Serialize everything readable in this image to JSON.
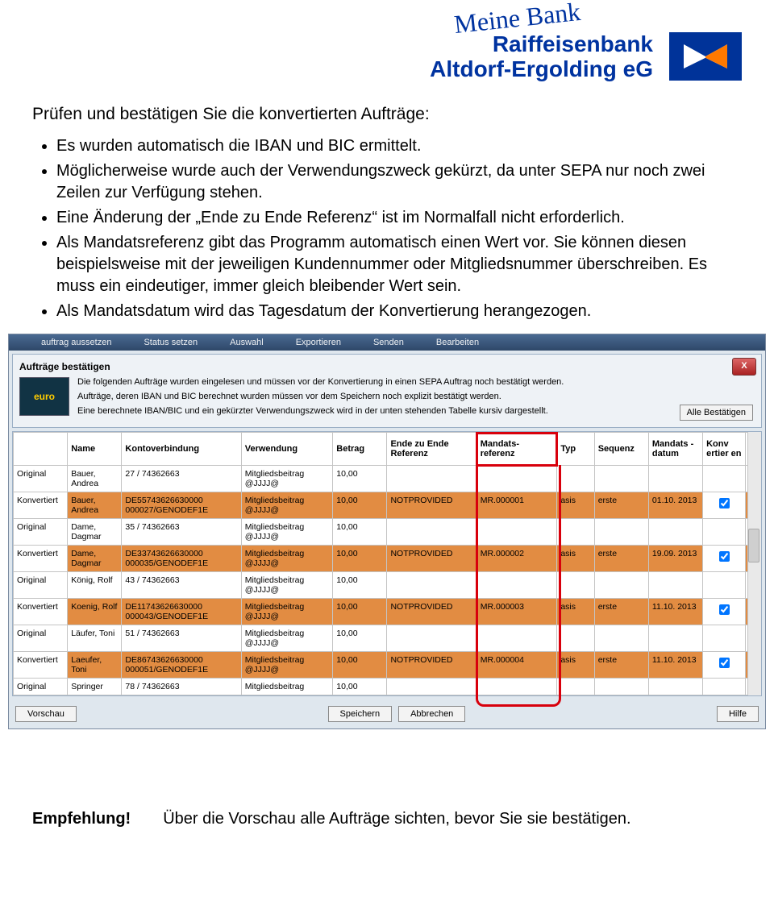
{
  "header": {
    "meine": "Meine Bank",
    "bank1": "Raiffeisenbank",
    "bank2": "Altdorf-Ergolding eG"
  },
  "intro": "Prüfen und bestätigen Sie die konvertierten Aufträge:",
  "bullets": [
    "Es wurden automatisch die IBAN und BIC ermittelt.",
    "Möglicherweise wurde auch der Verwendungszweck gekürzt, da unter SEPA nur noch zwei Zeilen zur Verfügung stehen.",
    "Eine Änderung der „Ende zu Ende Referenz“ ist im Normalfall nicht erforderlich.",
    "Als Mandatsreferenz gibt das Programm automatisch einen Wert vor. Sie können diesen beispielsweise mit der jeweiligen Kundennummer oder Mitgliedsnummer überschreiben. Es muss ein eindeutiger, immer gleich bleibender Wert sein.",
    "Als Mandatsdatum wird das Tagesdatum der Konvertierung herangezogen."
  ],
  "toolbar": [
    "auftrag aussetzen",
    "Status setzen",
    "Auswahl",
    "Exportieren",
    "Senden",
    "Bearbeiten"
  ],
  "dialog": {
    "title": "Aufträge bestätigen",
    "line1": "Die folgenden Aufträge wurden eingelesen und müssen vor der Konvertierung in einen SEPA Auftrag noch bestätigt werden.",
    "line2": "Aufträge, deren IBAN und BIC berechnet wurden müssen vor dem Speichern noch explizit bestätigt werden.",
    "line3": "Eine berechnete IBAN/BIC und ein gekürzter Verwendungszweck wird in der unten stehenden Tabelle kursiv dargestellt.",
    "euro": "euro",
    "alle": "Alle Bestätigen"
  },
  "cols": {
    "c0": "",
    "c1": "Name",
    "c2": "Kontoverbindung",
    "c3": "Verwendung",
    "c4": "Betrag",
    "c5": "Ende zu Ende Referenz",
    "c6": "Mandats-\nreferenz",
    "c7": "Typ",
    "c8": "Sequenz",
    "c9": "Mandats - datum",
    "c10": "Konv ertier en"
  },
  "rows": [
    {
      "t": "Original",
      "n": "Bauer, Andrea",
      "k": "27 / 74362663",
      "v": "Mitgliedsbeitrag @JJJJ@",
      "b": "10,00",
      "e": "",
      "m": "",
      "typ": "",
      "seq": "",
      "d": "",
      "cb": false,
      "cls": "orig"
    },
    {
      "t": "Konvertiert",
      "n": "Bauer, Andrea",
      "k": "DE55743626630000 000027/GENODEF1E",
      "v": "Mitgliedsbeitrag @JJJJ@",
      "b": "10,00",
      "e": "NOTPROVIDED",
      "m": "MR.000001",
      "typ": "asis",
      "seq": "erste",
      "d": "01.10. 2013",
      "cb": true,
      "cls": "konv"
    },
    {
      "t": "Original",
      "n": "Dame, Dagmar",
      "k": "35 / 74362663",
      "v": "Mitgliedsbeitrag @JJJJ@",
      "b": "10,00",
      "e": "",
      "m": "",
      "typ": "",
      "seq": "",
      "d": "",
      "cb": false,
      "cls": "orig"
    },
    {
      "t": "Konvertiert",
      "n": "Dame, Dagmar",
      "k": "DE33743626630000 000035/GENODEF1E",
      "v": "Mitgliedsbeitrag @JJJJ@",
      "b": "10,00",
      "e": "NOTPROVIDED",
      "m": "MR.000002",
      "typ": "asis",
      "seq": "erste",
      "d": "19.09. 2013",
      "cb": true,
      "cls": "konv"
    },
    {
      "t": "Original",
      "n": "König, Rolf",
      "k": "43 / 74362663",
      "v": "Mitgliedsbeitrag @JJJJ@",
      "b": "10,00",
      "e": "",
      "m": "",
      "typ": "",
      "seq": "",
      "d": "",
      "cb": false,
      "cls": "orig"
    },
    {
      "t": "Konvertiert",
      "n": "Koenig, Rolf",
      "k": "DE11743626630000 000043/GENODEF1E",
      "v": "Mitgliedsbeitrag @JJJJ@",
      "b": "10,00",
      "e": "NOTPROVIDED",
      "m": "MR.000003",
      "typ": "asis",
      "seq": "erste",
      "d": "11.10. 2013",
      "cb": true,
      "cls": "konv"
    },
    {
      "t": "Original",
      "n": "Läufer, Toni",
      "k": "51 / 74362663",
      "v": "Mitgliedsbeitrag @JJJJ@",
      "b": "10,00",
      "e": "",
      "m": "",
      "typ": "",
      "seq": "",
      "d": "",
      "cb": false,
      "cls": "orig"
    },
    {
      "t": "Konvertiert",
      "n": "Laeufer, Toni",
      "k": "DE86743626630000 000051/GENODEF1E",
      "v": "Mitgliedsbeitrag @JJJJ@",
      "b": "10,00",
      "e": "NOTPROVIDED",
      "m": "MR.000004",
      "typ": "asis",
      "seq": "erste",
      "d": "11.10. 2013",
      "cb": true,
      "cls": "konv"
    },
    {
      "t": "Original",
      "n": "Springer",
      "k": "78 / 74362663",
      "v": "Mitgliedsbeitrag",
      "b": "10,00",
      "e": "",
      "m": "",
      "typ": "",
      "seq": "",
      "d": "",
      "cb": false,
      "cls": "partial"
    }
  ],
  "buttons": {
    "vorschau": "Vorschau",
    "speichern": "Speichern",
    "abbrechen": "Abbrechen",
    "hilfe": "Hilfe"
  },
  "footer": {
    "rec": "Empfehlung!",
    "text": "Über die Vorschau alle Aufträge sichten, bevor Sie sie bestätigen."
  }
}
